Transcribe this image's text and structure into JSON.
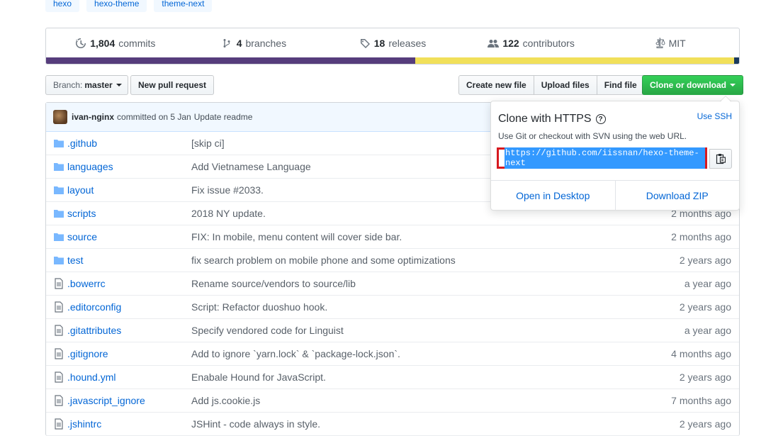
{
  "topics": [
    "hexo",
    "hexo-theme",
    "theme-next"
  ],
  "summary": {
    "commits": {
      "count": "1,804",
      "label": "commits"
    },
    "branches": {
      "count": "4",
      "label": "branches"
    },
    "releases": {
      "count": "18",
      "label": "releases"
    },
    "contributors": {
      "count": "122",
      "label": "contributors"
    },
    "license": "MIT"
  },
  "language_bar": [
    {
      "color": "#563d7c",
      "fraction": 0.533
    },
    {
      "color": "#f1e05a",
      "fraction": 0.46
    },
    {
      "color": "#1a3a5e",
      "fraction": 0.007
    }
  ],
  "toolbar": {
    "branch_label": "Branch:",
    "branch_value": "master",
    "new_pr": "New pull request",
    "create_file": "Create new file",
    "upload_files": "Upload files",
    "find_file": "Find file",
    "clone": "Clone or download"
  },
  "commit": {
    "author": "ivan-nginx",
    "committed": "committed on 5 Jan",
    "message": "Update readme"
  },
  "files": [
    {
      "type": "dir",
      "name": ".github",
      "message": "[skip ci]",
      "age": ""
    },
    {
      "type": "dir",
      "name": "languages",
      "message": "Add Vietnamese Language",
      "age": ""
    },
    {
      "type": "dir",
      "name": "layout",
      "message": "Fix issue #2033.",
      "age": ""
    },
    {
      "type": "dir",
      "name": "scripts",
      "message": "2018 NY update.",
      "age": "2 months ago"
    },
    {
      "type": "dir",
      "name": "source",
      "message": "FIX: In mobile, menu content will cover side bar.",
      "age": "2 months ago"
    },
    {
      "type": "dir",
      "name": "test",
      "message": "fix search problem on mobile phone and some optimizations",
      "age": "2 years ago"
    },
    {
      "type": "file",
      "name": ".bowerrc",
      "message": "Rename source/vendors to source/lib",
      "age": "a year ago"
    },
    {
      "type": "file",
      "name": ".editorconfig",
      "message": "Script: Refactor duoshuo hook.",
      "age": "2 years ago"
    },
    {
      "type": "file",
      "name": ".gitattributes",
      "message": "Specify vendored code for Linguist",
      "age": "a year ago"
    },
    {
      "type": "file",
      "name": ".gitignore",
      "message": "Add to ignore `yarn.lock` & `package-lock.json`.",
      "age": "4 months ago"
    },
    {
      "type": "file",
      "name": ".hound.yml",
      "message": "Enabale Hound for JavaScript.",
      "age": "2 years ago"
    },
    {
      "type": "file",
      "name": ".javascript_ignore",
      "message": "Add js.cookie.js",
      "age": "7 months ago"
    },
    {
      "type": "file",
      "name": ".jshintrc",
      "message": "JSHint - code always in style.",
      "age": "2 years ago"
    }
  ],
  "clone_popover": {
    "title": "Clone with HTTPS",
    "use_ssh": "Use SSH",
    "description": "Use Git or checkout with SVN using the web URL.",
    "url": "https://github.com/iissnan/hexo-theme-next",
    "open_desktop": "Open in Desktop",
    "download_zip": "Download ZIP"
  }
}
